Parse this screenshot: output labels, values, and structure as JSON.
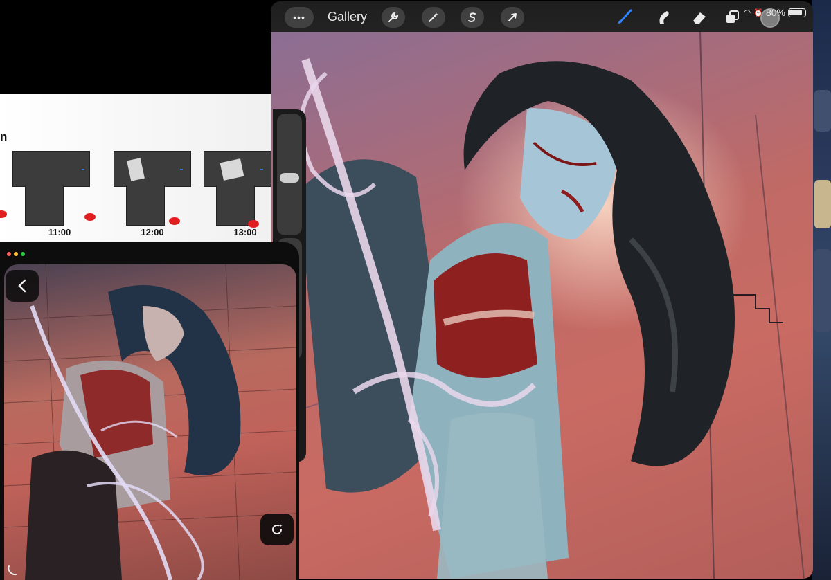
{
  "timelapse": {
    "heading": "n",
    "frames": [
      {
        "time": "11:00"
      },
      {
        "time": "12:00"
      },
      {
        "time": "13:00"
      }
    ],
    "blob_color": "#e02020"
  },
  "procreate": {
    "toolbar": {
      "more_label": "•••",
      "gallery_label": "Gallery",
      "left_tools": [
        "wrench-icon",
        "magic-wand-icon",
        "selection-s-icon",
        "transform-arrow-icon"
      ],
      "right_tools": [
        "brush-icon",
        "smudge-icon",
        "eraser-icon",
        "layers-icon"
      ],
      "active_tool_color": "#2f86ff"
    },
    "status": {
      "battery_percent": "80%"
    }
  },
  "reference": {
    "window_controls": [
      "#ff5f57",
      "#febc2e",
      "#28c840"
    ]
  }
}
